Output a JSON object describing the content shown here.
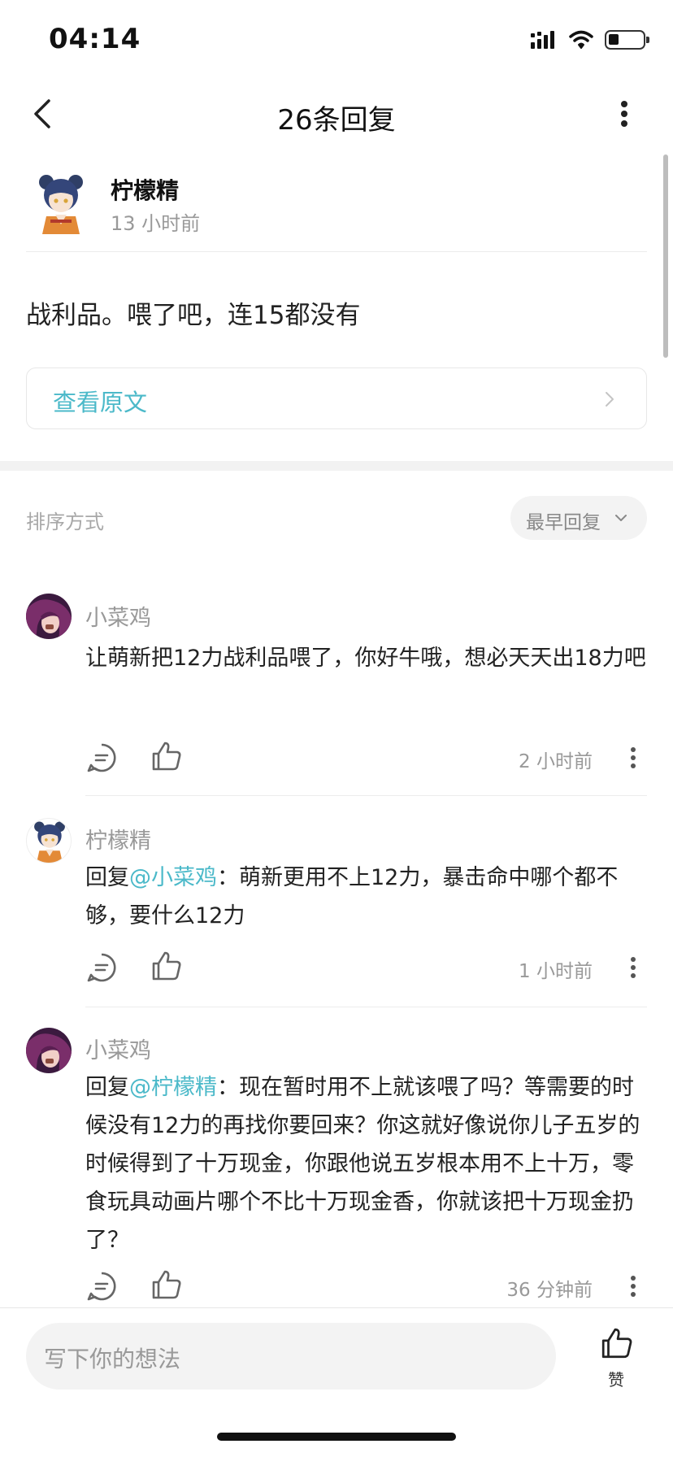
{
  "status_bar": {
    "time": "04:14"
  },
  "nav": {
    "title": "26条回复",
    "back_icon": "chevron-left-icon",
    "more_icon": "more-vertical-icon"
  },
  "post": {
    "author": "柠檬精",
    "time": "13 小时前",
    "content": "战利品。喂了吧，连15都没有",
    "view_original": "查看原文"
  },
  "sort": {
    "label": "排序方式",
    "selected": "最早回复"
  },
  "comments": [
    {
      "name": "小菜鸡",
      "text": "让萌新把12力战利品喂了，你好牛哦，想必天天出18力吧",
      "time": "2 小时前"
    },
    {
      "name": "柠檬精",
      "reply_prefix": "回复",
      "mention": "@小菜鸡",
      "text": "：萌新更用不上12力，暴击命中哪个都不够，要什么12力",
      "time": "1 小时前"
    },
    {
      "name": "小菜鸡",
      "reply_prefix": "回复",
      "mention": "@柠檬精",
      "text": "：现在暂时用不上就该喂了吗？等需要的时候没有12力的再找你要回来？你这就好像说你儿子五岁的时候得到了十万现金，你跟他说五岁根本用不上十万，零食玩具动画片哪个不比十万现金香，你就该把十万现金扔了？",
      "time": "36 分钟前"
    }
  ],
  "bottom": {
    "placeholder": "写下你的想法",
    "like_label": "赞"
  },
  "colors": {
    "accent": "#4bb9c9",
    "muted": "#999999",
    "divider": "#ececec"
  }
}
